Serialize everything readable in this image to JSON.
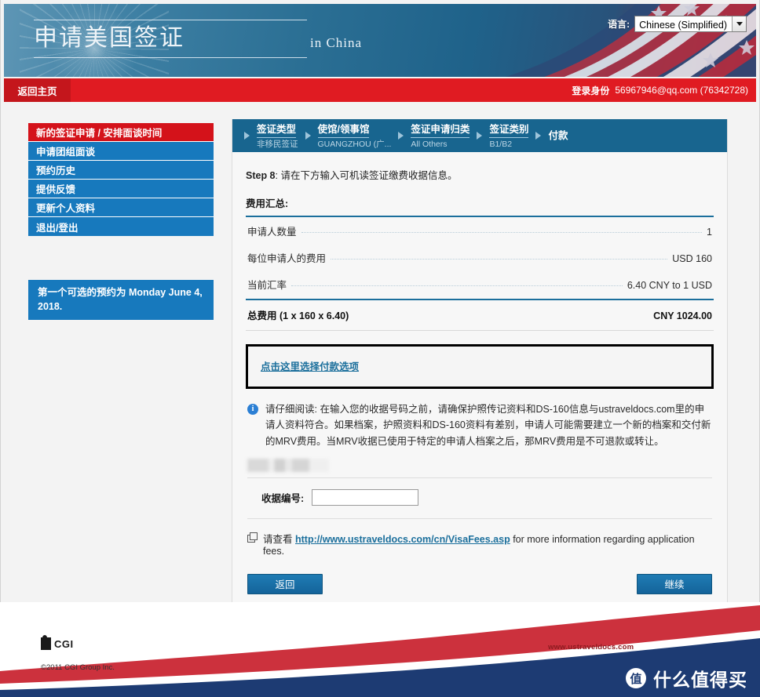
{
  "banner": {
    "title": "申请美国签证",
    "subtitle": "in China",
    "language_label": "语言:",
    "language_value": "Chinese (Simplified)"
  },
  "loginbar": {
    "home_button": "返回主页",
    "login_label": "登录身份",
    "login_value": "56967946@qq.com (76342728)"
  },
  "sidebar": {
    "items": [
      {
        "label": "新的签证申请 / 安排面谈时间"
      },
      {
        "label": "申请团组面谈"
      },
      {
        "label": "预约历史"
      },
      {
        "label": "提供反馈"
      },
      {
        "label": "更新个人资料"
      },
      {
        "label": "退出/登出"
      }
    ],
    "appointment_note": "第一个可选的预约为 Monday June 4, 2018."
  },
  "breadcrumbs": [
    {
      "title": "签证类型",
      "sub": "非移民签证"
    },
    {
      "title": "使馆/领事馆",
      "sub": "GUANGZHOU (广..."
    },
    {
      "title": "签证申请归类",
      "sub": "All Others"
    },
    {
      "title": "签证类别",
      "sub": "B1/B2"
    },
    {
      "title": "付款",
      "sub": ""
    }
  ],
  "main": {
    "step_label": "Step 8",
    "step_text": ": 请在下方输入可机读签证缴费收据信息。",
    "fee_summary_title": "费用汇总:",
    "fee_rows": [
      {
        "key": "申请人数量",
        "value": "1"
      },
      {
        "key": "每位申请人的费用",
        "value": "USD 160"
      },
      {
        "key": "当前汇率",
        "value": "6.40 CNY to 1 USD"
      }
    ],
    "total_label": "总费用",
    "total_formula": "(1 x 160 x 6.40)",
    "total_amount": "CNY 1024.00",
    "payment_options_link": "点击这里选择付款选项",
    "notice_text": "请仔细阅读: 在输入您的收据号码之前，请确保护照传记资料和DS-160信息与ustraveldocs.com里的申请人资料符合。如果档案，护照资料和DS-160资料有差别，申请人可能需要建立一个新的档案和交付新的MRV费用。当MRV收据已使用于特定的申请人档案之后，那MRV费用是不可退款或转让。",
    "receipt_label": "收据编号:",
    "receipt_value": "",
    "receipt_placeholder": "",
    "fees_link_prefix": "请查看",
    "fees_link_url": "http://www.ustraveldocs.com/cn/VisaFees.asp",
    "fees_link_suffix": "for more information regarding application fees.",
    "back_button": "返回",
    "continue_button": "继续"
  },
  "footer": {
    "logo_text": "CGI",
    "copyright": "©2011 CGI Group Inc.",
    "url": "www.ustraveldocs.com",
    "watermark_badge": "值",
    "watermark_text": "什么值得买"
  },
  "colors": {
    "red": "#e01b22",
    "dark_red": "#c4161c",
    "blue": "#1779bd",
    "crumb_blue": "#18658f",
    "link_blue": "#1b6f9c",
    "navy": "#1d3b73"
  }
}
